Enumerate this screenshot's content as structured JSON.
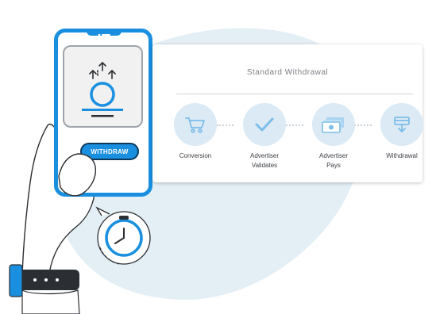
{
  "phone": {
    "button_label": "WITHDRAW",
    "icon": "coin-withdraw-icon"
  },
  "card": {
    "title": "Standard Withdrawal",
    "steps": [
      {
        "label": "Conversion",
        "icon": "shopping-cart-icon"
      },
      {
        "label": "Advertiser\nValidates",
        "icon": "checkmark-icon"
      },
      {
        "label": "Advertiser\nPays",
        "icon": "cash-icon"
      },
      {
        "label": "Withdrawal",
        "icon": "withdrawal-icon"
      }
    ]
  },
  "extras": {
    "timer_icon": "stopwatch-icon",
    "watch_icon": "wristwatch-icon"
  },
  "colors": {
    "accent": "#1a8fe0",
    "blob": "#e4eef5",
    "step_circle": "#dbeaf5"
  }
}
